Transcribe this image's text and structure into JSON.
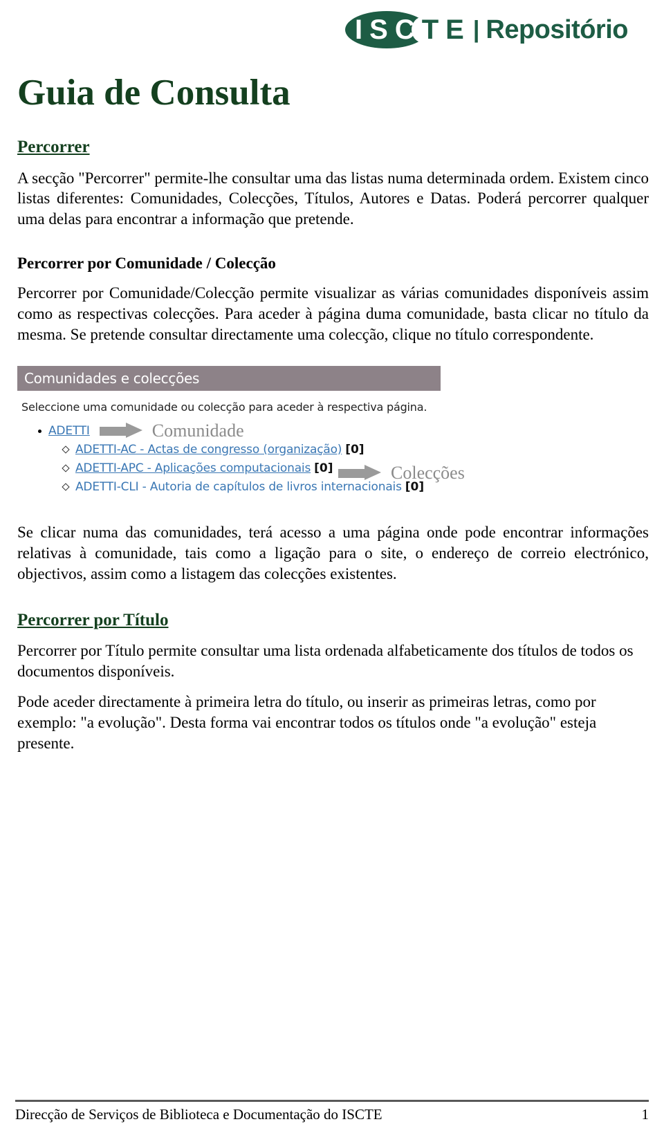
{
  "logo": {
    "oval_color": "#1d5c44",
    "letters": [
      {
        "ch": "I",
        "on_oval": true
      },
      {
        "ch": "S",
        "on_oval": true
      },
      {
        "ch": "C",
        "on_oval": true
      },
      {
        "ch": "T",
        "on_oval": false
      },
      {
        "ch": "E",
        "on_oval": false
      }
    ],
    "separator": "|",
    "word": "Repositório",
    "alt": "ISCTE | Repositório"
  },
  "document": {
    "title": "Guia de Consulta",
    "title_color": "#14401f"
  },
  "sections": {
    "percorrer": {
      "heading": "Percorrer",
      "paragraph": "A secção \"Percorrer\" permite-lhe consultar uma das listas numa determinada ordem. Existem cinco listas diferentes: Comunidades, Colecções, Títulos, Autores e Datas. Poderá percorrer qualquer uma delas para encontrar a informação que pretende."
    },
    "comunidade": {
      "heading": "Percorrer por Comunidade / Colecção",
      "paragraph": "Percorrer por Comunidade/Colecção permite visualizar as várias comunidades disponíveis assim como as respectivas colecções. Para aceder à página duma comunidade, basta clicar no título da mesma. Se pretende consultar directamente uma colecção, clique no título correspondente.",
      "after_paragraph": "Se clicar numa das comunidades, terá acesso a uma página onde pode encontrar informações relativas à comunidade, tais como a ligação para o site, o endereço de correio electrónico, objectivos, assim como a listagem das colecções existentes."
    },
    "titulo": {
      "heading": "Percorrer por Título",
      "paragraph_1": "Percorrer por Título permite consultar uma lista ordenada alfabeticamente dos títulos de todos os documentos disponíveis.",
      "paragraph_2": "Pode aceder directamente à primeira letra do título, ou inserir as primeiras letras, como por exemplo: \"a evolução\". Desta forma vai encontrar todos os títulos onde \"a evolução\" esteja presente."
    }
  },
  "screenshot": {
    "header_title": "Comunidades e colecções",
    "header_bg": "#8d8288",
    "instruction": "Seleccione uma comunidade ou colecção para aceder à respectiva página.",
    "community": {
      "label": "ADETTI",
      "annotation": "Comunidade"
    },
    "collections_annotation": "Colecções",
    "collections": [
      {
        "label": "ADETTI-AC - Actas de congresso (organização)",
        "count": "[0]",
        "underlined": true
      },
      {
        "label": "ADETTI-APC - Aplicações computacionais",
        "count": "[0]",
        "underlined": true
      },
      {
        "label": "ADETTI-CLI - Autoria de capítulos de livros internacionais",
        "count": "[0]",
        "underlined": false
      }
    ],
    "link_color": "#3a77b4"
  },
  "footer": {
    "text": "Direcção de Serviços de Biblioteca e Documentação do ISCTE",
    "page_number": "1"
  }
}
